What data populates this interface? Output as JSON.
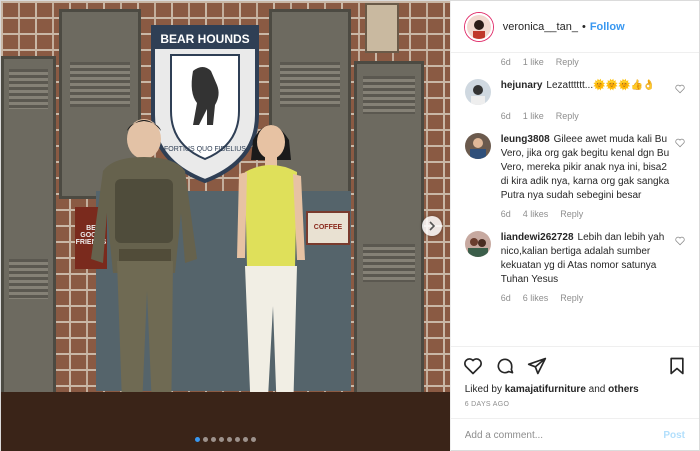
{
  "header": {
    "username": "veronica__tan_",
    "separator": "•",
    "follow_label": "Follow"
  },
  "photo": {
    "shield_title": "BEAR HOUNDS",
    "shield_motto": "FORTIUS QUO FIDELIUS",
    "sign_coffee": "COFFEE",
    "sign_friends": "BE GOOD FRIENDS",
    "carousel_dots": 8,
    "active_dot": 0
  },
  "comments": {
    "first_meta": {
      "time": "6d",
      "likes": "1 like",
      "reply": "Reply"
    },
    "items": [
      {
        "username": "hejunary",
        "text": "Lezatttttt...🌞🌞🌞👍👌",
        "time": "6d",
        "likes": "1 like",
        "reply": "Reply"
      },
      {
        "username": "leung3808",
        "text": "Gileee awet muda kali Bu Vero, jika org gak begitu kenal dgn Bu Vero, mereka pikir anak nya ini, bisa2 di kira adik nya, karna org gak sangka Putra nya sudah sebegini besar",
        "time": "6d",
        "likes": "4 likes",
        "reply": "Reply"
      },
      {
        "username": "liandewi262728",
        "text": "Lebih dan lebih yah nico,kalian bertiga adalah sumber kekuatan yg di Atas nomor satunya Tuhan Yesus",
        "time": "6d",
        "likes": "6 likes",
        "reply": "Reply"
      }
    ]
  },
  "likes": {
    "prefix": "Liked by",
    "user": "kamajatifurniture",
    "and": "and",
    "others": "others"
  },
  "date": "6 DAYS AGO",
  "add_comment": {
    "placeholder": "Add a comment...",
    "post_label": "Post"
  },
  "colors": {
    "accent": "#3897f0",
    "text": "#262626",
    "muted": "#8e8e8e",
    "post_disabled": "#b2dffc"
  }
}
